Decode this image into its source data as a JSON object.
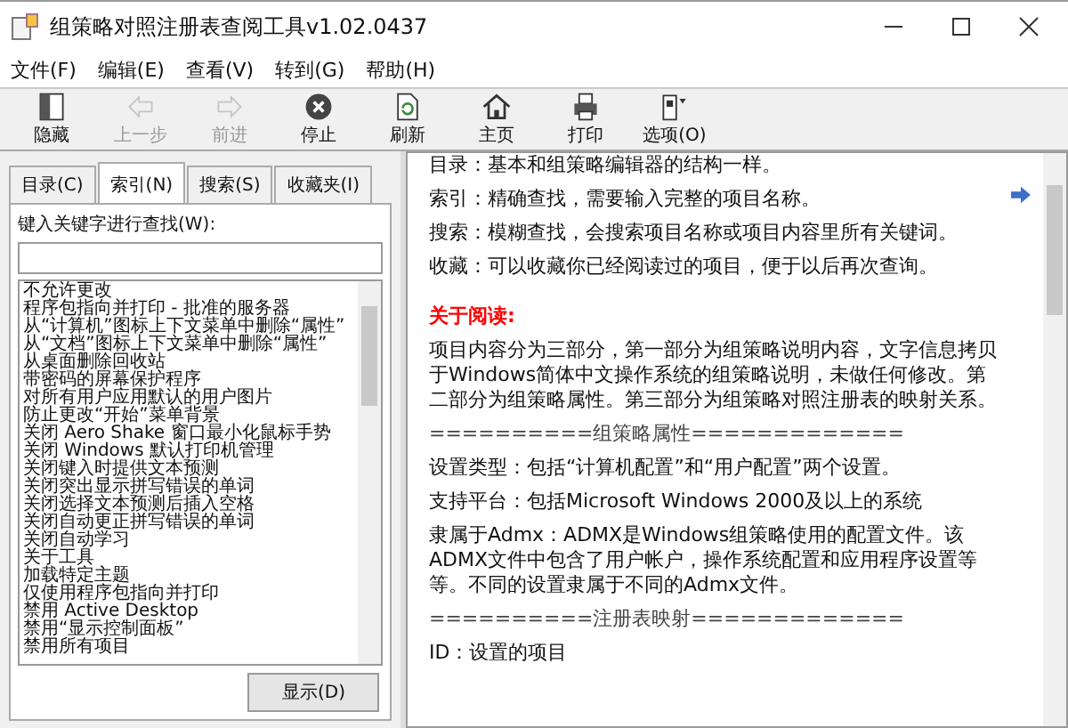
{
  "window": {
    "title": "组策略对照注册表查阅工具v1.02.0437"
  },
  "menu": [
    "文件(F)",
    "编辑(E)",
    "查看(V)",
    "转到(G)",
    "帮助(H)"
  ],
  "toolbar": [
    {
      "label": "隐藏",
      "disabled": false
    },
    {
      "label": "上一步",
      "disabled": true
    },
    {
      "label": "前进",
      "disabled": true
    },
    {
      "label": "停止",
      "disabled": false
    },
    {
      "label": "刷新",
      "disabled": false
    },
    {
      "label": "主页",
      "disabled": false
    },
    {
      "label": "打印",
      "disabled": false
    },
    {
      "label": "选项(O)",
      "disabled": false
    }
  ],
  "tabs": [
    {
      "label": "目录(C)",
      "selected": false
    },
    {
      "label": "索引(N)",
      "selected": true
    },
    {
      "label": "搜索(S)",
      "selected": false
    },
    {
      "label": "收藏夹(I)",
      "selected": false
    }
  ],
  "index": {
    "prompt": "键入关键字进行查找(W):",
    "items": [
      "不允许更改",
      "程序包指向并打印 - 批准的服务器",
      "从“计算机”图标上下文菜单中删除“属性”",
      "从“文档”图标上下文菜单中删除“属性”",
      "从桌面删除回收站",
      "带密码的屏幕保护程序",
      "对所有用户应用默认的用户图片",
      "防止更改“开始”菜单背景",
      "关闭 Aero Shake 窗口最小化鼠标手势",
      "关闭 Windows 默认打印机管理",
      "关闭键入时提供文本预测",
      "关闭突出显示拼写错误的单词",
      "关闭选择文本预测后插入空格",
      "关闭自动更正拼写错误的单词",
      "关闭自动学习",
      "关于工具",
      "加载特定主题",
      "仅使用程序包指向并打印",
      "禁用 Active Desktop",
      "禁用“显示控制面板”",
      "禁用所有项目"
    ],
    "show_button": "显示(D)"
  },
  "content": [
    {
      "kind": "text",
      "text": "目录：基本和组策略编辑器的结构一样。"
    },
    {
      "kind": "text",
      "text": "索引：精确查找，需要输入完整的项目名称。"
    },
    {
      "kind": "text",
      "text": "搜索：模糊查找，会搜索项目名称或项目内容里所有关键词。"
    },
    {
      "kind": "text",
      "text": "收藏：可以收藏你已经阅读过的项目，便于以后再次查询。"
    },
    {
      "kind": "heading",
      "text": "关于阅读:"
    },
    {
      "kind": "text",
      "text": "项目内容分为三部分，第一部分为组策略说明内容，文字信息拷贝于Windows简体中文操作系统的组策略说明，未做任何修改。第二部分为组策略属性。第三部分为组策略对照注册表的映射关系。"
    },
    {
      "kind": "separator",
      "text": "==========组策略属性============="
    },
    {
      "kind": "text",
      "text": "设置类型：包括“计算机配置”和“用户配置”两个设置。"
    },
    {
      "kind": "text",
      "text": "支持平台：包括Microsoft Windows 2000及以上的系统"
    },
    {
      "kind": "text",
      "text": "隶属于Admx：ADMX是Windows组策略使用的配置文件。该ADMX文件中包含了用户帐户，操作系统配置和应用程序设置等等。不同的设置隶属于不同的Admx文件。"
    },
    {
      "kind": "separator",
      "text": "==========注册表映射============="
    },
    {
      "kind": "text",
      "text": "ID：设置的项目"
    }
  ]
}
